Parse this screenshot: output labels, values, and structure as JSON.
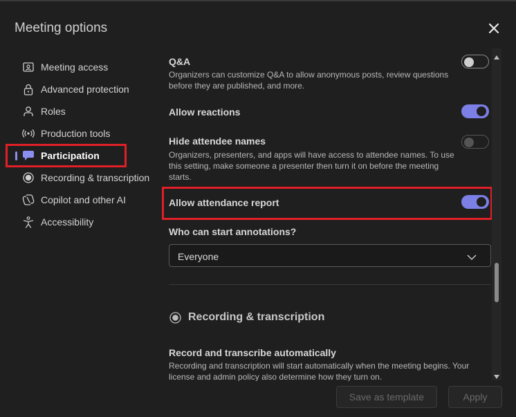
{
  "dialog": {
    "title": "Meeting options"
  },
  "sidebar": {
    "items": [
      {
        "label": "Meeting access",
        "icon": "id-card-icon"
      },
      {
        "label": "Advanced protection",
        "icon": "lock-icon"
      },
      {
        "label": "Roles",
        "icon": "person-icon"
      },
      {
        "label": "Production tools",
        "icon": "broadcast-icon"
      },
      {
        "label": "Participation",
        "icon": "chat-bubble-icon",
        "active": true
      },
      {
        "label": "Recording & transcription",
        "icon": "record-icon"
      },
      {
        "label": "Copilot and other AI",
        "icon": "copilot-icon"
      },
      {
        "label": "Accessibility",
        "icon": "accessibility-icon"
      }
    ]
  },
  "content": {
    "qa": {
      "title": "Q&A",
      "description": "Organizers can customize Q&A to allow anonymous posts, review questions before they are published, and more.",
      "state": "off"
    },
    "reactions": {
      "title": "Allow reactions",
      "state": "on"
    },
    "hide_names": {
      "title": "Hide attendee names",
      "description": "Organizers, presenters, and apps will have access to attendee names. To use this setting, make someone a presenter then turn it on before the meeting starts.",
      "state": "disabled"
    },
    "attendance": {
      "title": "Allow attendance report",
      "state": "on"
    },
    "annotations": {
      "title": "Who can start annotations?",
      "selected": "Everyone"
    },
    "recording_section": {
      "title": "Recording & transcription"
    },
    "record_auto": {
      "title": "Record and transcribe automatically",
      "description": "Recording and transcription will start automatically when the meeting begins. Your license and admin policy also determine how they turn on."
    }
  },
  "footer": {
    "save_template_label": "Save as template",
    "apply_label": "Apply"
  },
  "colors": {
    "accent": "#7b7fe6",
    "highlight": "#e01f27",
    "background": "#1f1f1f"
  }
}
